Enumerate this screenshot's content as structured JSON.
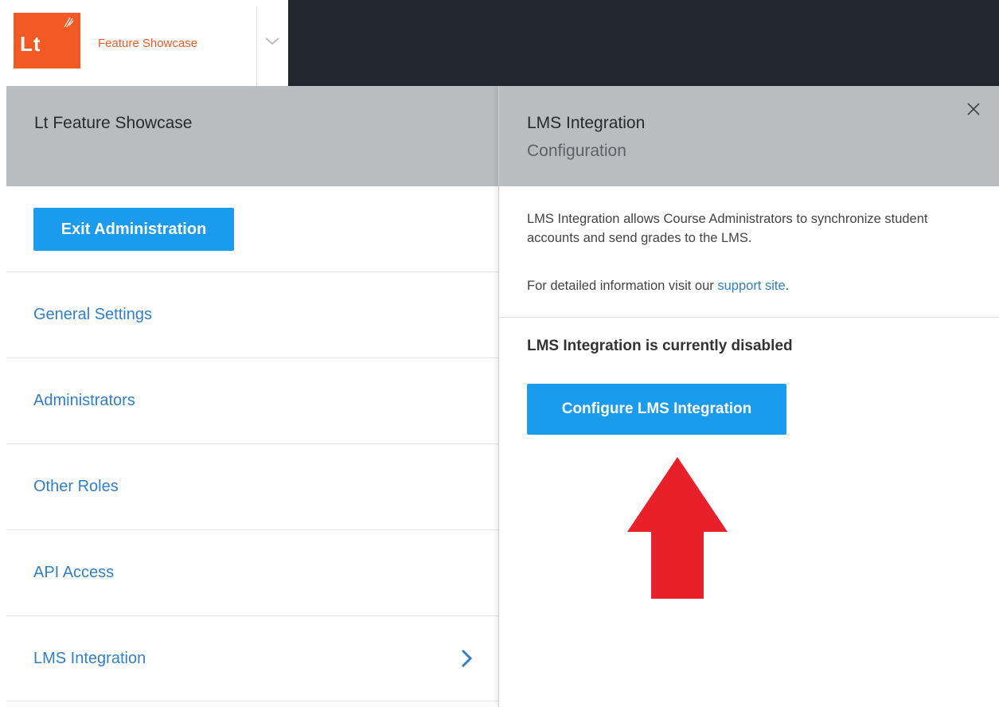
{
  "topbar": {
    "logo_text": "Lt",
    "brand_name": "Feature Showcase"
  },
  "left_panel": {
    "title": "Lt Feature Showcase",
    "exit_button": "Exit Administration",
    "nav_items": [
      {
        "label": "General Settings"
      },
      {
        "label": "Administrators"
      },
      {
        "label": "Other Roles"
      },
      {
        "label": "API Access"
      },
      {
        "label": "LMS Integration",
        "active": true
      }
    ]
  },
  "right_panel": {
    "title": "LMS Integration",
    "subtitle": "Configuration",
    "description": "LMS Integration allows Course Administrators to synchronize student accounts and send grades to the LMS.",
    "support_prefix": "For detailed information visit our",
    "support_link": "support site",
    "support_suffix": ".",
    "status": "LMS Integration is currently disabled",
    "configure_button": "Configure LMS Integration"
  },
  "colors": {
    "brand_orange": "#f15a24",
    "primary_blue": "#1b9bee",
    "link_blue": "#2f80c8",
    "header_gray": "#b9bdc0",
    "topbar_dark": "#22262e",
    "annotation_red": "#e8202a"
  },
  "icons": {
    "dropdown": "chevron-down-icon",
    "nav_active": "chevron-right-icon",
    "close": "close-icon",
    "annotation": "up-arrow-icon"
  }
}
